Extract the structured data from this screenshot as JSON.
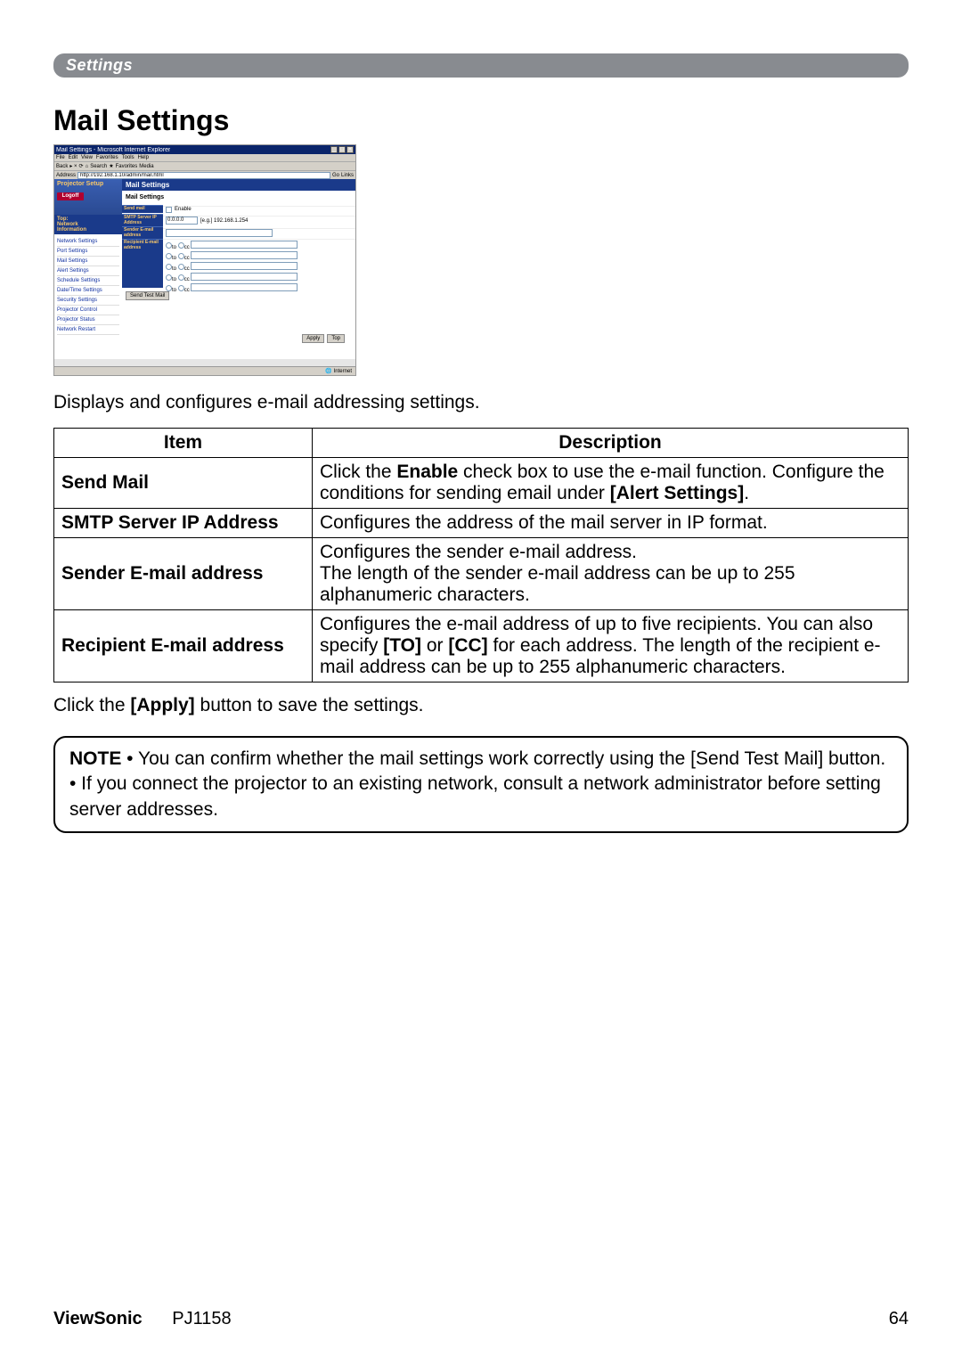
{
  "settings_bar": "Settings",
  "heading": "Mail Settings",
  "screenshot": {
    "title": "Mail Settings - Microsoft Internet Explorer",
    "menu": [
      "File",
      "Edit",
      "View",
      "Favorites",
      "Tools",
      "Help"
    ],
    "toolbar": [
      "Back",
      "",
      "Search",
      "Favorites",
      "Media"
    ],
    "address_label": "Address",
    "url": "http://192.168.1.10/admin/mail.html",
    "go": "Go",
    "links": "Links",
    "sidebar_title": "Projector Setup",
    "logoff": "Logoff",
    "top": "Top:",
    "network": "Network",
    "information": "Information",
    "nav": [
      "Network Settings",
      "Port Settings",
      "Mail Settings",
      "Alert Settings",
      "Schedule Settings",
      "Date/Time Settings",
      "Security Settings",
      "Projector Control",
      "Projector Status",
      "Network Restart"
    ],
    "main_title": "Mail Settings",
    "sub_title": "Mail Settings",
    "rows": {
      "send_mail": "Send mail",
      "enable": "Enable",
      "smtp": "SMTP Server IP Address",
      "smtp_val": "0.0.0.0",
      "smtp_ex": "[e.g.] 192.168.1.254",
      "sender": "Sender E-mail address",
      "recipient": "Recipient E-mail address",
      "to": "to",
      "cc": "cc"
    },
    "send_test": "Send Test Mail",
    "apply": "Apply",
    "top_btn": "Top",
    "status_internet": "Internet"
  },
  "caption": "Displays and configures e-mail addressing settings.",
  "table": {
    "head_item": "Item",
    "head_desc": "Description",
    "rows": [
      {
        "item": "Send Mail",
        "desc_parts": [
          "Click the ",
          "Enable",
          " check box to use the e-mail function. Configure the conditions for sending email under ",
          "[Alert Settings]",
          "."
        ]
      },
      {
        "item": "SMTP Server IP Address",
        "desc_parts": [
          "Configures the address of the mail server in IP format."
        ]
      },
      {
        "item": "Sender E-mail address",
        "desc_parts": [
          "Configures the sender e-mail address.",
          "\n",
          "The length of the sender e-mail address can be up to 255 alphanumeric characters."
        ]
      },
      {
        "item": "Recipient E-mail address",
        "desc_parts": [
          "Configures the e-mail address of up to five recipients. You can also specify ",
          "[TO]",
          " or ",
          "[CC]",
          " for each address. The length of the recipient e-mail address can be up to 255 alphanumeric characters."
        ]
      }
    ]
  },
  "after_table": {
    "pre": "Click the ",
    "bold": "[Apply]",
    "post": " button to save the settings."
  },
  "note": {
    "label": "NOTE",
    "line1": " • You can confirm whether the mail settings work correctly using the [Send Test Mail] button.",
    "line2": "• If you connect the projector to an existing network, consult a network administrator before setting server addresses."
  },
  "footer": {
    "brand": "ViewSonic",
    "model": "PJ1158",
    "page": "64"
  }
}
